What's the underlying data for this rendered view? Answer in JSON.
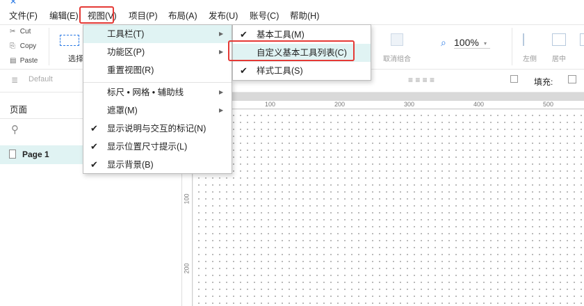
{
  "menubar": {
    "file": "文件(F)",
    "edit": "编辑(E)",
    "view": "视图(V)",
    "project": "项目(P)",
    "layout": "布局(A)",
    "publish": "发布(U)",
    "account": "账号(C)",
    "help": "帮助(H)"
  },
  "toolbar": {
    "cut": "Cut",
    "copy": "Copy",
    "paste": "Paste",
    "select": "选择",
    "ungroup": "取消组合",
    "zoom": "100%",
    "align_left": "左侧",
    "align_center": "居中"
  },
  "stylebar": {
    "style_default": "Default",
    "fill_label": "填充:"
  },
  "pages": {
    "header": "页面",
    "items": [
      "Page 1"
    ]
  },
  "view_menu": {
    "toolbar": "工具栏(T)",
    "ribbon": "功能区(P)",
    "reset_view": "重置视图(R)",
    "rulers": "标尺 • 网格 • 辅助线",
    "mask": "遮罩(M)",
    "show_notes": "显示说明与交互的标记(N)",
    "show_position": "显示位置尺寸提示(L)",
    "show_background": "显示背景(B)"
  },
  "toolbar_submenu": {
    "basic_tools": "基本工具(M)",
    "customize": "自定义基本工具列表(C)",
    "style_tools": "样式工具(S)"
  },
  "rulers": {
    "top": [
      "100",
      "200",
      "300",
      "400",
      "500"
    ],
    "left": [
      "100",
      "200"
    ]
  },
  "colors": {
    "highlight": "#e0f3f3",
    "annotation": "#e53935",
    "accent": "#2c7be5"
  }
}
